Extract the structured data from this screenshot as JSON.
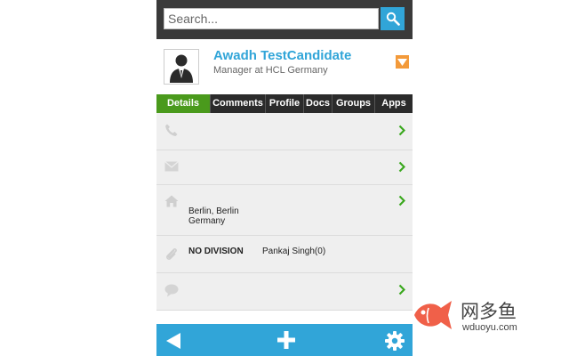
{
  "search": {
    "placeholder": "Search..."
  },
  "candidate": {
    "name": "Awadh TestCandidate",
    "title": "Manager at HCL Germany"
  },
  "tabs": [
    {
      "label": "Details",
      "active": true
    },
    {
      "label": "Comments",
      "active": false
    },
    {
      "label": "Profile",
      "active": false
    },
    {
      "label": "Docs",
      "active": false
    },
    {
      "label": "Groups",
      "active": false
    },
    {
      "label": "Apps",
      "active": false
    }
  ],
  "details": {
    "address_line1": "Berlin, Berlin",
    "address_line2": "Germany",
    "division": "NO DIVISION",
    "owner": "Pankaj Singh(0)"
  },
  "watermark": {
    "cn": "网多鱼",
    "en": "wduoyu.com"
  },
  "colors": {
    "accent": "#31a5d8",
    "active_tab": "#4a9a1c",
    "chevron": "#3aa81e",
    "dropdown": "#f39a3a"
  }
}
